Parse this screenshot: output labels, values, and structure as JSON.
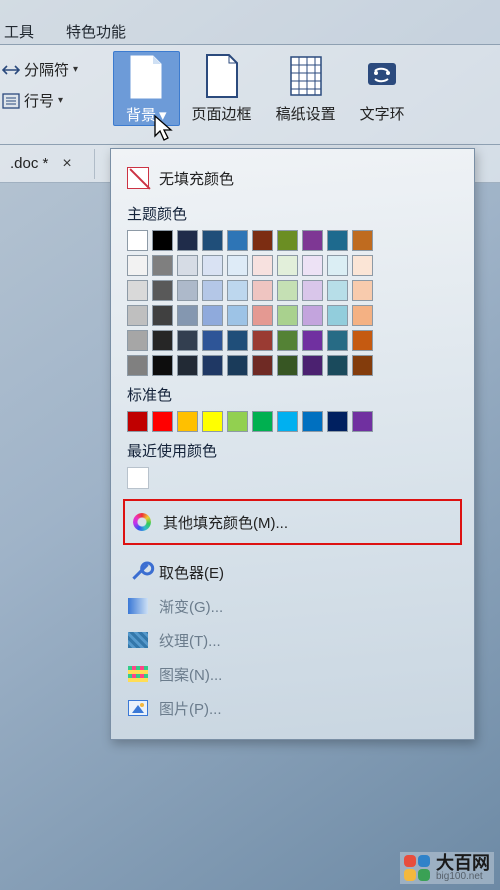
{
  "menubar": {
    "tools": "工具",
    "special": "特色功能"
  },
  "ribbon_left": {
    "separator": "分隔符",
    "line_number": "行号"
  },
  "ribbon": {
    "background": "背景",
    "page_border": "页面边框",
    "manuscript": "稿纸设置",
    "text_wrap": "文字环"
  },
  "doc_tab": {
    "name": ".doc *"
  },
  "dropdown": {
    "no_fill": "无填充颜色",
    "theme_colors": "主题颜色",
    "standard_colors": "标准色",
    "recent_colors": "最近使用颜色",
    "more_fill": "其他填充颜色(M)...",
    "eyedropper": "取色器(E)",
    "gradient": "渐变(G)...",
    "texture": "纹理(T)...",
    "pattern": "图案(N)...",
    "picture": "图片(P)...",
    "theme_grid": [
      [
        "#ffffff",
        "#000000",
        "#1f2c4a",
        "#1f4e79",
        "#2e75b6",
        "#7c2d12",
        "#6b8e23",
        "#7e3794",
        "#1e6a8e",
        "#bf6b1f"
      ],
      [
        "#f2f2f2",
        "#7f7f7f",
        "#d6dce5",
        "#d9e2f3",
        "#deebf7",
        "#f7e1df",
        "#e2efda",
        "#ede2f5",
        "#dbeef4",
        "#fbe5d6"
      ],
      [
        "#d9d9d9",
        "#595959",
        "#adb9ca",
        "#b4c7e7",
        "#bdd7ee",
        "#efc5c1",
        "#c5e0b4",
        "#d9c6ea",
        "#b7dee8",
        "#f8cbad"
      ],
      [
        "#bfbfbf",
        "#404040",
        "#8497b0",
        "#8faadc",
        "#9dc3e6",
        "#e49992",
        "#a9d18e",
        "#c3a4dd",
        "#92cddc",
        "#f4b183"
      ],
      [
        "#a6a6a6",
        "#262626",
        "#333f50",
        "#2e5597",
        "#1f4e79",
        "#9a3b33",
        "#548235",
        "#7030a0",
        "#276b85",
        "#c55a11"
      ],
      [
        "#808080",
        "#0d0d0d",
        "#222a35",
        "#1f3864",
        "#1a3b5a",
        "#6f2a24",
        "#375623",
        "#4b2170",
        "#1a4a5c",
        "#833c0c"
      ]
    ],
    "standard_row": [
      "#c00000",
      "#ff0000",
      "#ffc000",
      "#ffff00",
      "#92d050",
      "#00b050",
      "#00b0f0",
      "#0070c0",
      "#002060",
      "#7030a0"
    ]
  },
  "watermark": {
    "brand": "大百网",
    "site": "big100.net"
  }
}
